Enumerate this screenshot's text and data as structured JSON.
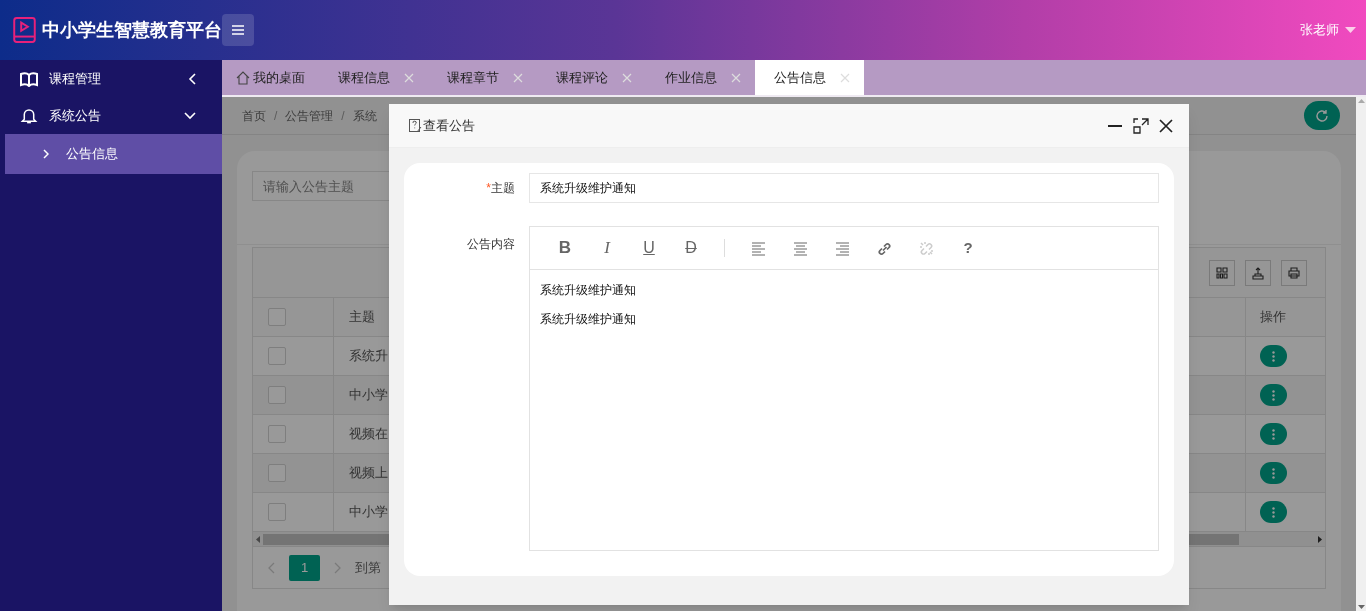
{
  "header": {
    "title": "中小学生智慧教育平台",
    "user": "张老师"
  },
  "sidebar": {
    "items": [
      {
        "label": "课程管理",
        "expanded": false
      },
      {
        "label": "系统公告",
        "expanded": true,
        "children": [
          {
            "label": "公告信息",
            "selected": true
          }
        ]
      }
    ]
  },
  "tabs": [
    {
      "label": "我的桌面",
      "kind": "home",
      "selected": false
    },
    {
      "label": "课程信息",
      "kind": "closable",
      "selected": false
    },
    {
      "label": "课程章节",
      "kind": "closable",
      "selected": false
    },
    {
      "label": "课程评论",
      "kind": "closable",
      "selected": false
    },
    {
      "label": "作业信息",
      "kind": "closable",
      "selected": false
    },
    {
      "label": "公告信息",
      "kind": "closable",
      "selected": true
    }
  ],
  "breadcrumb": {
    "separator": "/",
    "items": [
      "首页",
      "公告管理",
      "系统"
    ]
  },
  "search": {
    "placeholder": "请输入公告主题"
  },
  "table": {
    "columns": [
      "主题",
      "操作"
    ],
    "all_checked": false,
    "rows": [
      {
        "title": "系统升",
        "checked": false
      },
      {
        "title": "中小学",
        "checked": false
      },
      {
        "title": "视频在",
        "checked": false
      },
      {
        "title": "视频上",
        "checked": false
      },
      {
        "title": "中小学",
        "checked": false
      }
    ]
  },
  "pagination": {
    "pages": [
      {
        "label": "1",
        "selected": true
      }
    ],
    "goto": "到第"
  },
  "modal": {
    "title": "查看公告",
    "subject": {
      "label": "主题",
      "required_mark": "*",
      "value": "系统升级维护通知"
    },
    "content": {
      "label": "公告内容",
      "tools": [
        {
          "kind": "bold",
          "label": "B",
          "disabled": false
        },
        {
          "kind": "italic",
          "label": "I",
          "disabled": false
        },
        {
          "kind": "underline",
          "label": "U",
          "disabled": false
        },
        {
          "kind": "strike",
          "label": "D",
          "disabled": false
        },
        {
          "kind": "separator"
        },
        {
          "kind": "align-left",
          "disabled": false
        },
        {
          "kind": "align-center",
          "disabled": false
        },
        {
          "kind": "align-right",
          "disabled": false
        },
        {
          "kind": "link",
          "disabled": false
        },
        {
          "kind": "unlink",
          "disabled": true
        },
        {
          "kind": "help",
          "label": "?",
          "disabled": false
        }
      ],
      "paragraphs": [
        "系统升级维护通知",
        "系统升级维护通知"
      ]
    }
  }
}
